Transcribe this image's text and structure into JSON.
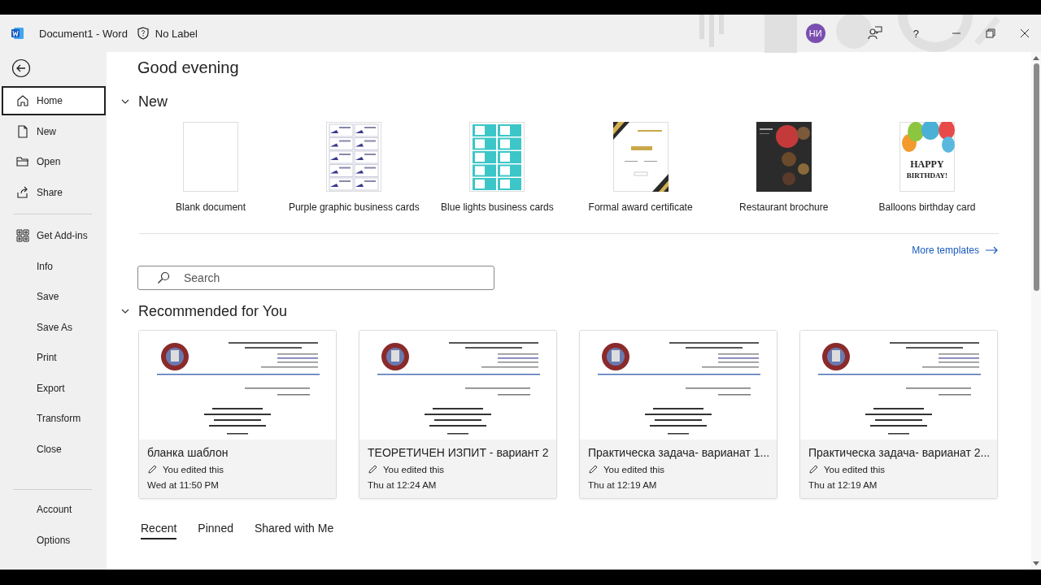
{
  "window": {
    "title": "Document1  -  Word",
    "label": "No Label",
    "avatar": "НИ",
    "help": "?"
  },
  "sidebar": {
    "groups": [
      {
        "items": [
          {
            "label": "Home",
            "selected": true
          },
          {
            "label": "New",
            "selected": false
          },
          {
            "label": "Open",
            "selected": false
          },
          {
            "label": "Share",
            "selected": false
          }
        ]
      },
      {
        "items": [
          {
            "label": "Get Add-ins",
            "selected": false
          },
          {
            "label": "Info",
            "selected": false
          },
          {
            "label": "Save",
            "selected": false
          },
          {
            "label": "Save As",
            "selected": false
          },
          {
            "label": "Print",
            "selected": false
          },
          {
            "label": "Export",
            "selected": false
          },
          {
            "label": "Transform",
            "selected": false
          },
          {
            "label": "Close",
            "selected": false
          }
        ]
      },
      {
        "items": [
          {
            "label": "Account",
            "selected": false
          },
          {
            "label": "Options",
            "selected": false
          }
        ]
      }
    ]
  },
  "greeting": "Good evening",
  "new_section": {
    "title": "New",
    "expanded": true,
    "templates": [
      {
        "name": "Blank document",
        "kind": "blank"
      },
      {
        "name": "Purple graphic business cards",
        "kind": "purple-cards"
      },
      {
        "name": "Blue lights business cards",
        "kind": "blue-cards"
      },
      {
        "name": "Formal award certificate",
        "kind": "certificate"
      },
      {
        "name": "Restaurant brochure",
        "kind": "brochure"
      },
      {
        "name": "Balloons birthday card",
        "kind": "balloons",
        "preview_text": [
          "HAPPY",
          "BIRTHDAY!"
        ]
      }
    ],
    "more": "More templates"
  },
  "search": {
    "placeholder": "Search"
  },
  "recommended": {
    "title": "Recommended for You",
    "expanded": true,
    "files": [
      {
        "name": "бланка шаблон",
        "activity": "You edited this",
        "time": "Wed at 11:50 PM"
      },
      {
        "name": "ТЕОРЕТИЧЕН ИЗПИТ - вариант 2",
        "activity": "You edited this",
        "time": "Thu at 12:24 AM"
      },
      {
        "name": "Практическа задача- варианат 1...",
        "activity": "You edited this",
        "time": "Thu at 12:19 AM"
      },
      {
        "name": "Практическа задача- варианат 2...",
        "activity": "You edited this",
        "time": "Thu at 12:19 AM"
      }
    ]
  },
  "tabs": [
    {
      "label": "Recent",
      "selected": true
    },
    {
      "label": "Pinned",
      "selected": false
    },
    {
      "label": "Shared with Me",
      "selected": false
    }
  ]
}
